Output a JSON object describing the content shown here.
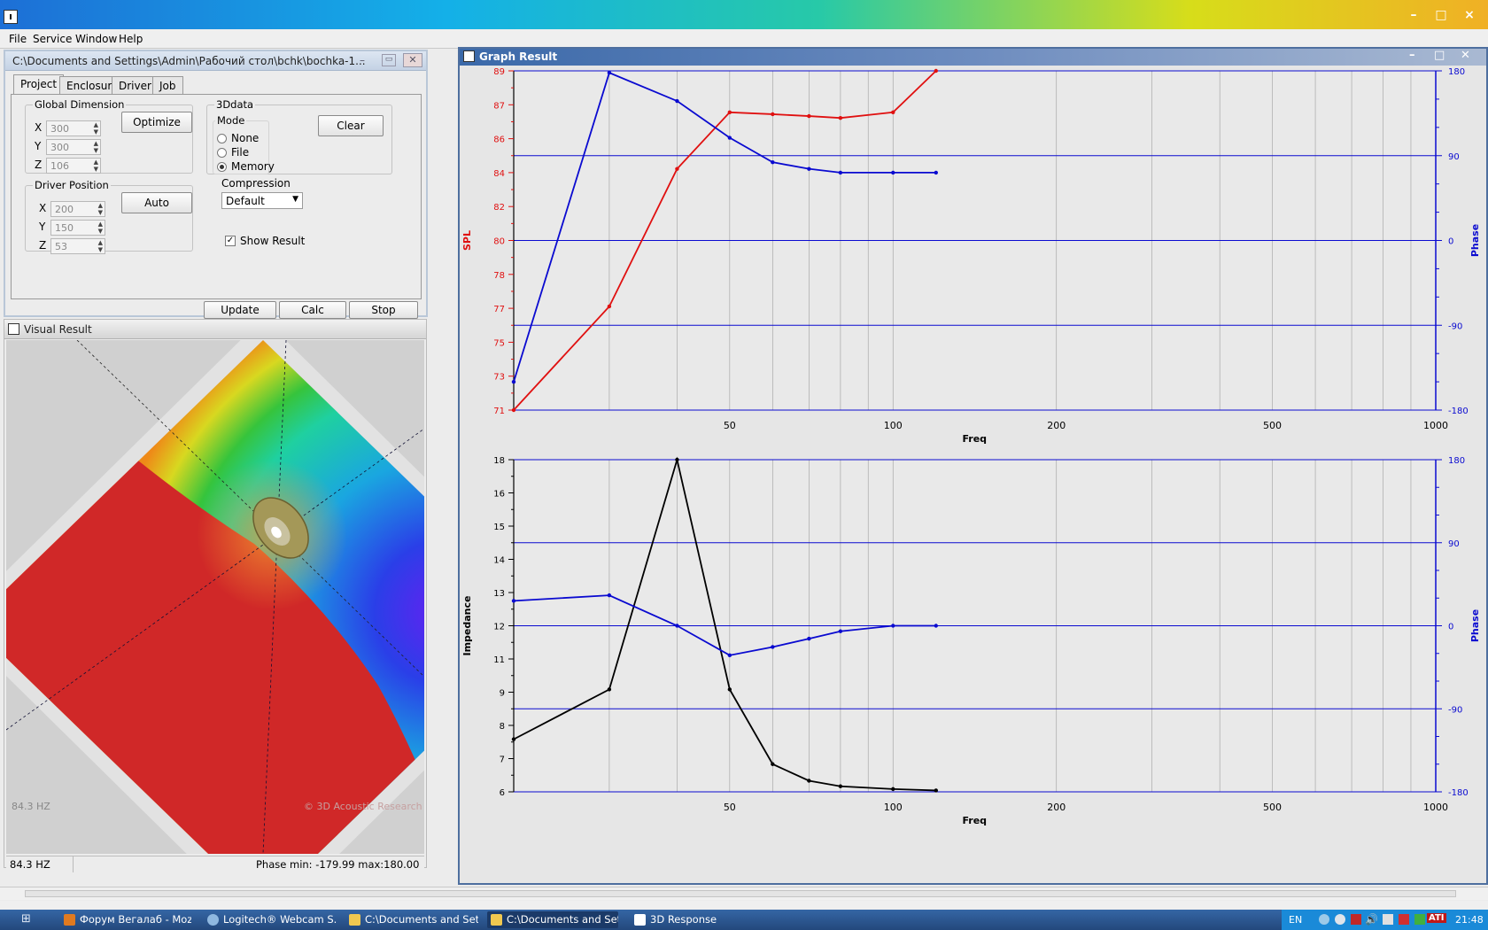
{
  "menu": [
    "File",
    "Service",
    "Window",
    "Help"
  ],
  "project_window": {
    "title": "C:\\Documents and Settings\\Admin\\Рабочий стол\\bchk\\bochka-1...",
    "tabs": [
      "Project",
      "Enclosure",
      "Driver",
      "Job"
    ],
    "active_tab": "Project",
    "global_dimension": {
      "legend": "Global Dimension",
      "x_label": "X",
      "x": "300",
      "y_label": "Y",
      "y": "300",
      "z_label": "Z",
      "z": "106"
    },
    "optimize_label": "Optimize",
    "driver_position": {
      "legend": "Driver Position",
      "x_label": "X",
      "x": "200",
      "y_label": "Y",
      "y": "150",
      "z_label": "Z",
      "z": "53"
    },
    "auto_label": "Auto",
    "data3d": {
      "legend": "3Ddata",
      "mode_legend": "Mode",
      "options": [
        "None",
        "File",
        "Memory"
      ],
      "selected": "Memory"
    },
    "clear_label": "Clear",
    "compression_label": "Compression",
    "compression_value": "Default",
    "show_result_label": "Show Result",
    "show_result_checked": true,
    "buttons": [
      "Update",
      "Calc",
      "Stop"
    ]
  },
  "visual_window": {
    "title": "Visual Result",
    "overlay_freq": "84.3 HZ",
    "watermark": "© 3D Acoustic Research",
    "status_freq": "84.3 HZ",
    "status_phase": "Phase min: -179.99 max:180.00"
  },
  "graph_window": {
    "title": "Graph Result",
    "spl_color": "#e01010",
    "phase_color": "#0a0ad0",
    "impedance_color": "#000000"
  },
  "chart_data": [
    {
      "type": "line",
      "xlabel": "Freq",
      "x_scale": "log",
      "xlim": [
        20,
        1000
      ],
      "x_ticks": [
        50,
        100,
        200,
        500,
        1000
      ],
      "ylabel": "SPL",
      "y_ticks": [
        "89",
        "87",
        "86",
        "84",
        "82",
        "80",
        "78",
        "77",
        "75",
        "73",
        "71"
      ],
      "ylim": [
        71,
        89
      ],
      "y2label": "Phase",
      "y2_ticks": [
        "180",
        "90",
        "0",
        "-90",
        "-180"
      ],
      "y2lim": [
        -180,
        180
      ],
      "grid": true,
      "x": [
        20,
        30,
        40,
        50,
        60,
        70,
        80,
        100,
        120
      ],
      "series": [
        {
          "axis": "left",
          "values": [
            71,
            76.5,
            83.8,
            86.8,
            86.7,
            86.6,
            86.5,
            86.8,
            89
          ]
        },
        {
          "axis": "right",
          "values": [
            -150,
            178,
            148,
            109,
            83,
            76,
            72,
            72,
            72
          ]
        }
      ]
    },
    {
      "type": "line",
      "xlabel": "Freq",
      "x_scale": "log",
      "xlim": [
        20,
        1000
      ],
      "x_ticks": [
        50,
        100,
        200,
        500,
        1000
      ],
      "ylabel": "Impedance",
      "y_ticks": [
        "18",
        "16",
        "15",
        "14",
        "13",
        "12",
        "11",
        "9",
        "8",
        "7",
        "6"
      ],
      "ylim": [
        6,
        18
      ],
      "y2label": "Phase",
      "y2_ticks": [
        "180",
        "90",
        "0",
        "-90",
        "-180"
      ],
      "y2lim": [
        -180,
        180
      ],
      "grid": true,
      "x": [
        20,
        30,
        40,
        50,
        60,
        70,
        80,
        100,
        120
      ],
      "series": [
        {
          "axis": "left",
          "values": [
            7.9,
            9.7,
            18,
            9.7,
            7,
            6.4,
            6.2,
            6.1,
            6.05
          ]
        },
        {
          "axis": "right",
          "values": [
            27,
            33,
            0,
            -32,
            -23,
            -14,
            -6,
            0,
            0
          ]
        }
      ]
    }
  ],
  "taskbar": {
    "items": [
      "Форум Вегалаб - Mozi...",
      "Logitech® Webcam S...",
      "C:\\Documents and Set...",
      "C:\\Documents and Set...",
      "3D Response"
    ],
    "lang": "EN",
    "clock": "21:48"
  }
}
